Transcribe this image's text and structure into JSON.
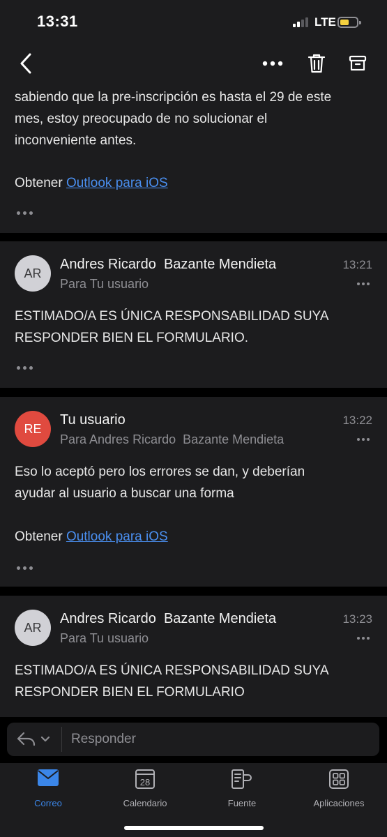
{
  "status": {
    "time": "13:31",
    "network": "LTE"
  },
  "nav": {
    "back_icon": "chevron-left-icon",
    "more_icon": "ellipsis-icon",
    "delete_icon": "trash-icon",
    "archive_icon": "archive-icon"
  },
  "messages": [
    {
      "body_lines": [
        "sabiendo que la pre-inscripción es hasta el 29 de este",
        "mes, estoy preocupado de no solucionar el",
        "inconveniente antes."
      ],
      "footer_prefix": "Obtener ",
      "footer_link": "Outlook para iOS"
    },
    {
      "avatar": "AR",
      "sender": "Andres Ricardo  Bazante Mendieta",
      "recipient": "Para Tu usuario",
      "time": "13:21",
      "body_lines": [
        "ESTIMADO/A ES ÚNICA RESPONSABILIDAD SUYA",
        "RESPONDER BIEN EL FORMULARIO."
      ]
    },
    {
      "avatar": "RE",
      "sender": "Tu usuario",
      "recipient": "Para Andres Ricardo  Bazante Mendieta",
      "time": "13:22",
      "body_lines": [
        "Eso lo aceptó pero los errores se dan, y deberían",
        "ayudar al usuario a buscar una forma"
      ],
      "footer_prefix": "Obtener ",
      "footer_link": "Outlook para iOS"
    },
    {
      "avatar": "AR",
      "sender": "Andres Ricardo  Bazante Mendieta",
      "recipient": "Para Tu usuario",
      "time": "13:23",
      "body_lines": [
        "ESTIMADO/A ES ÚNICA RESPONSABILIDAD SUYA",
        "RESPONDER BIEN EL FORMULARIO"
      ]
    }
  ],
  "reply": {
    "placeholder": "Responder"
  },
  "tabs": [
    {
      "label": "Correo",
      "icon": "mail-icon",
      "active": true
    },
    {
      "label": "Calendario",
      "icon": "calendar-icon",
      "calendar_day": "28"
    },
    {
      "label": "Fuente",
      "icon": "feed-icon"
    },
    {
      "label": "Aplicaciones",
      "icon": "apps-grid-icon"
    }
  ],
  "colors": {
    "accent": "#3b86e8",
    "link": "#4a8ff0",
    "avatar_red": "#e04a3f",
    "card_bg": "#1c1c1e"
  }
}
